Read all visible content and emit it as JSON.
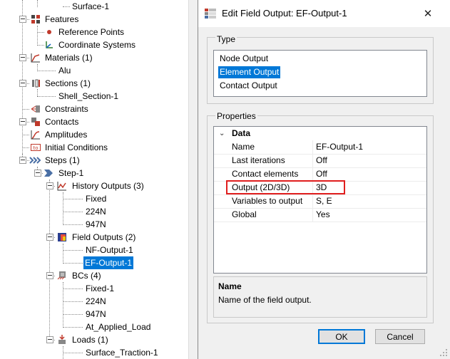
{
  "tree": {
    "surface_item": "Surface-1",
    "features": "Features",
    "reference_points": "Reference Points",
    "coordinate_systems": "Coordinate Systems",
    "materials": "Materials (1)",
    "material_alu": "Alu",
    "sections": "Sections (1)",
    "shell_section": "Shell_Section-1",
    "constraints": "Constraints",
    "contacts": "Contacts",
    "amplitudes": "Amplitudes",
    "initial_conditions": "Initial Conditions",
    "steps": "Steps (1)",
    "step1": "Step-1",
    "history_outputs": "History Outputs (3)",
    "ho_fixed": "Fixed",
    "ho_224n": "224N",
    "ho_947n": "947N",
    "field_outputs": "Field Outputs (2)",
    "nf_output": "NF-Output-1",
    "ef_output": "EF-Output-1",
    "bcs": "BCs (4)",
    "bc_fixed": "Fixed-1",
    "bc_224n": "224N",
    "bc_947n": "947N",
    "bc_applied": "At_Applied_Load",
    "loads": "Loads (1)",
    "surface_traction": "Surface_Traction-1"
  },
  "dialog": {
    "title": "Edit Field Output: EF-Output-1",
    "close_glyph": "✕",
    "type_group_label": "Type",
    "type_items": [
      "Node Output",
      "Element Output",
      "Contact Output"
    ],
    "selected_type": "Element Output",
    "properties_group_label": "Properties",
    "data_header": "Data",
    "chevron_glyph": "⌄",
    "properties": [
      {
        "key": "Name",
        "value": "EF-Output-1"
      },
      {
        "key": "Last iterations",
        "value": "Off"
      },
      {
        "key": "Contact elements",
        "value": "Off"
      },
      {
        "key": "Output (2D/3D)",
        "value": "3D"
      },
      {
        "key": "Variables to output",
        "value": "S, E"
      },
      {
        "key": "Global",
        "value": "Yes"
      }
    ],
    "description_title": "Name",
    "description_text": "Name of the field output.",
    "ok_label": "OK",
    "cancel_label": "Cancel",
    "highlight_color": "#e01e1e",
    "selection_color": "#0078d7"
  }
}
